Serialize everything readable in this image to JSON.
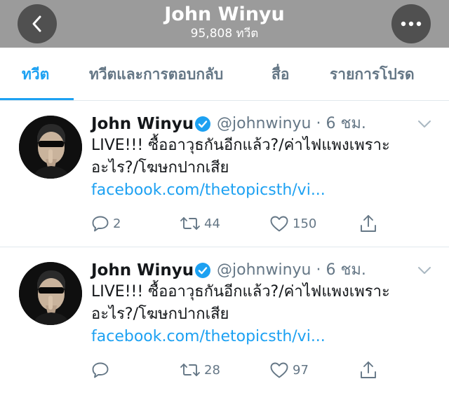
{
  "header": {
    "title": "John Winyu",
    "subtitle": "95,808 ทวีต",
    "back_icon": "chevron-left-icon",
    "more_icon": "more-horizontal-icon",
    "background": "#9b9b9b"
  },
  "tabs": [
    {
      "label": "ทวีต",
      "active": true
    },
    {
      "label": "ทวีตและการตอบกลับ",
      "active": false
    },
    {
      "label": "สื่อ",
      "active": false
    },
    {
      "label": "รายการโปรด",
      "active": false
    }
  ],
  "accent_color": "#1da1f2",
  "tweets": [
    {
      "name": "John Winyu",
      "handle": "@johnwinyu · 6 ชม.",
      "verified": true,
      "text_line1": "LIVE!!! ซื้ออาวุธกันอีกแล้ว?/ค่าไฟแพงเพราะ",
      "text_line2": "อะไร?/โฆษกปากเสีย",
      "link": "facebook.com/thetopicsth/vi...",
      "replies": "2",
      "retweets": "44",
      "likes": "150"
    },
    {
      "name": "John Winyu",
      "handle": "@johnwinyu · 6 ชม.",
      "verified": true,
      "text_line1": "LIVE!!! ซื้ออาวุธกันอีกแล้ว?/ค่าไฟแพงเพราะ",
      "text_line2": "อะไร?/โฆษกปากเสีย",
      "link": "facebook.com/thetopicsth/vi...",
      "replies": "",
      "retweets": "28",
      "likes": "97"
    }
  ]
}
